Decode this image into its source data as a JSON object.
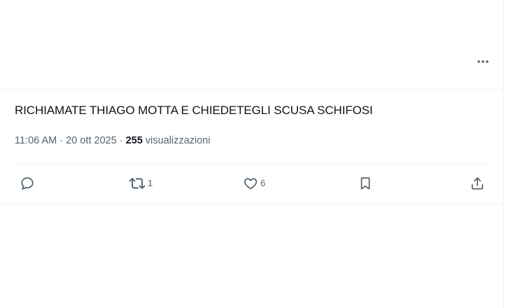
{
  "tweet": {
    "text": "RICHIAMATE THIAGO MOTTA E CHIEDETEGLI SCUSA SCHIFOSI",
    "time": "11:06 AM",
    "separator1": " · ",
    "date": "20 ott 2025",
    "separator2": " · ",
    "views_count": "255",
    "views_label": " visualizzazioni"
  },
  "actions": {
    "reply": {
      "icon": "reply-icon",
      "count": ""
    },
    "retweet": {
      "icon": "retweet-icon",
      "count": "1"
    },
    "like": {
      "icon": "heart-icon",
      "count": "6"
    },
    "bookmark": {
      "icon": "bookmark-icon",
      "count": ""
    },
    "share": {
      "icon": "share-icon",
      "count": ""
    }
  },
  "colors": {
    "text": "#0f1419",
    "secondary": "#536471",
    "divider": "#eff3f4",
    "background": "#ffffff"
  }
}
